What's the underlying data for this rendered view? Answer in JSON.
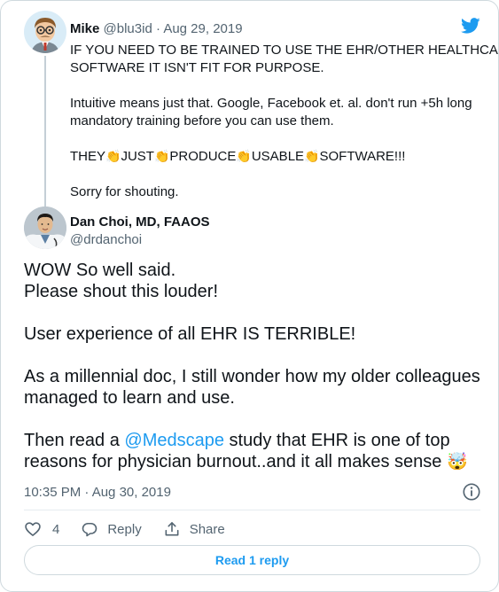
{
  "parent_tweet": {
    "name": "Mike",
    "handle": "@blu3id",
    "date": "Aug 29, 2019",
    "lines": [
      "IF YOU NEED TO BE TRAINED TO USE THE EHR/OTHER HEALTHCARE",
      "SOFTWARE IT ISN'T FIT FOR PURPOSE.",
      "Intuitive means just that. Google, Facebook et. al. don't run +5h long",
      "mandatory training before you can use them."
    ],
    "shout_words": [
      "THEY",
      "JUST",
      "PRODUCE",
      "USABLE",
      "SOFTWARE!!!"
    ],
    "closing": "Sorry for shouting."
  },
  "main_tweet": {
    "name": "Dan Choi, MD, FAAOS",
    "handle": "@drdanchoi",
    "line1": "WOW So well said.",
    "line2": "Please shout this louder!",
    "line3": "User experience of all EHR IS TERRIBLE!",
    "line4": "As a millennial doc, I still wonder how my older colleagues",
    "line5": "managed to learn and use.",
    "line6_prefix": "Then read a ",
    "mention": "@Medscape",
    "line6_suffix": " study that EHR is one of top",
    "line7": "reasons for physician burnout..and it all makes sense ",
    "emoji": "🤯",
    "timestamp": "10:35 PM · Aug 30, 2019"
  },
  "actions": {
    "like_count": "4",
    "reply_label": "Reply",
    "share_label": "Share"
  },
  "read_replies_label": "Read 1 reply",
  "icons": [
    "twitter-bird-icon",
    "info-icon",
    "heart-icon",
    "reply-bubble-icon",
    "share-icon",
    "clapping-hands-icon"
  ],
  "colors": {
    "brand": "#1d9bf0",
    "text": "#0f1419",
    "secondary": "#536471",
    "border": "#cfd9de"
  }
}
